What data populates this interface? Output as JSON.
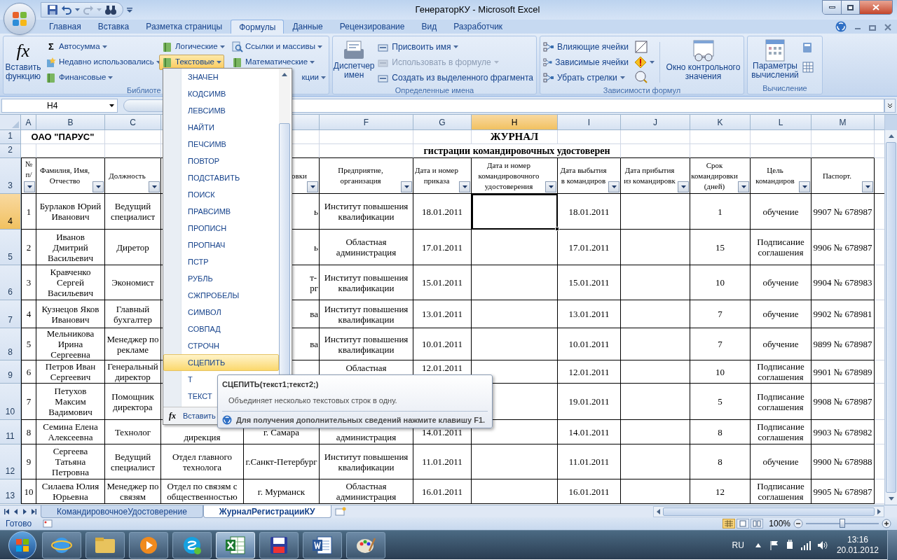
{
  "window": {
    "title": "ГенераторКУ - Microsoft Excel"
  },
  "tabs": [
    {
      "label": "Главная",
      "selected": false
    },
    {
      "label": "Вставка",
      "selected": false
    },
    {
      "label": "Разметка страницы",
      "selected": false
    },
    {
      "label": "Формулы",
      "selected": true
    },
    {
      "label": "Данные",
      "selected": false
    },
    {
      "label": "Рецензирование",
      "selected": false
    },
    {
      "label": "Вид",
      "selected": false
    },
    {
      "label": "Разработчик",
      "selected": false
    }
  ],
  "ribbon": {
    "library": {
      "label": "Библиоте",
      "insert_function": {
        "symbol": "fx",
        "label": "Вставить функцию"
      },
      "items": [
        {
          "label": "Автосумма",
          "kind": "sigma",
          "symbol": "Σ",
          "dropdown": true,
          "open": false
        },
        {
          "label": "Недавно использовались",
          "kind": "star",
          "dropdown": true,
          "open": false
        },
        {
          "label": "Финансовые",
          "kind": "book",
          "dropdown": true,
          "open": false
        },
        {
          "label": "Логические",
          "kind": "book",
          "dropdown": true,
          "open": false
        },
        {
          "label": "Текстовые",
          "kind": "book",
          "dropdown": true,
          "open": true
        },
        {
          "label": "Ссылки и массивы",
          "kind": "lens",
          "dropdown": true,
          "open": false
        },
        {
          "label": "Математические",
          "kind": "book",
          "dropdown": true,
          "open": false
        },
        {
          "label": "кции",
          "kind": "clipped",
          "dropdown": true,
          "open": false
        }
      ]
    },
    "names": {
      "label": "Определенные имена",
      "manager": "Диспетчер имен",
      "items": [
        {
          "label": "Присвоить имя",
          "dropdown": true,
          "disabled": false
        },
        {
          "label": "Использовать в формуле",
          "dropdown": true,
          "disabled": true
        },
        {
          "label": "Создать из выделенного фрагмента",
          "dropdown": false,
          "disabled": false
        }
      ]
    },
    "auditing": {
      "label": "Зависимости формул",
      "watch": "Окно контрольного значения",
      "items": [
        {
          "label": "Влияющие ячейки",
          "dropdown": false
        },
        {
          "label": "Зависимые ячейки",
          "dropdown": false
        },
        {
          "label": "Убрать стрелки",
          "dropdown": true
        }
      ]
    },
    "calculation": {
      "label": "Вычисление",
      "options": "Параметры вычислений"
    }
  },
  "formula_bar": {
    "name_box": "H4"
  },
  "sheet": {
    "columns": [
      {
        "label": "A",
        "selected": false
      },
      {
        "label": "B",
        "selected": false
      },
      {
        "label": "C",
        "selected": false
      },
      null,
      null,
      {
        "label": "F",
        "selected": false
      },
      {
        "label": "G",
        "selected": false
      },
      {
        "label": "H",
        "selected": true
      },
      {
        "label": "I",
        "selected": false
      },
      {
        "label": "J",
        "selected": false
      },
      {
        "label": "K",
        "selected": false
      },
      {
        "label": "L",
        "selected": false
      },
      {
        "label": "M",
        "selected": false
      }
    ],
    "title_rows": [
      {
        "number": "1",
        "selected": false
      },
      {
        "number": "2",
        "selected": false
      }
    ],
    "company": "ОАО \"ПАРУС\"",
    "heading": "ЖУРНАЛ",
    "subheading": "гистрации командировочных удостоверен",
    "header_row": {
      "number": "3",
      "selected": false,
      "cells": [
        {
          "text": "№ п/",
          "filter": true
        },
        {
          "text": "Фамилия, Имя, Отчество",
          "filter": true
        },
        {
          "text": "Должность",
          "filter": true
        },
        null,
        {
          "text": "овки",
          "filter": true,
          "kind": "clipped"
        },
        {
          "text": "Предприятие, организация",
          "filter": true
        },
        {
          "text": "Дата и номер приказа",
          "filter": true
        },
        {
          "text": "Дата и номер командировочного удостоверения",
          "filter": true
        },
        {
          "text": "Дата выбытия в командиров",
          "filter": true
        },
        {
          "text": "Дата прибытия из командировк",
          "filter": true
        },
        {
          "text": "Срок командировки (дней)",
          "filter": true
        },
        {
          "text": "Цель командиров",
          "filter": true
        },
        {
          "text": "Паспорт.",
          "filter": true
        }
      ]
    },
    "data_rows": [
      {
        "number": "4",
        "selected": true,
        "cells": [
          "1",
          "Бурлаков Юрий Иванович",
          "Ведущий специалист",
          null,
          {
            "text": "ь",
            "kind": "clipped"
          },
          "Институт повышения квалификации",
          "18.01.2011",
          null,
          "18.01.2011",
          null,
          "1",
          "обучение",
          "9907 № 678987"
        ]
      },
      {
        "number": "5",
        "selected": false,
        "cells": [
          "2",
          "Иванов Дмитрий Васильевич",
          "Диретор",
          null,
          {
            "text": "ь",
            "kind": "clipped"
          },
          "Областная администрация",
          "17.01.2011",
          null,
          "17.01.2011",
          null,
          "15",
          "Подписание соглашения",
          "9906 № 678987"
        ]
      },
      {
        "number": "6",
        "selected": false,
        "cells": [
          "3",
          "Кравченко Сергей Васильевич",
          "Экономист",
          null,
          {
            "text": "т-\nрг",
            "kind": "clipped"
          },
          "Институт повышения квалификации",
          "15.01.2011",
          null,
          "15.01.2011",
          null,
          "10",
          "обучение",
          "9904 № 678983"
        ]
      },
      {
        "number": "7",
        "selected": false,
        "cells": [
          "4",
          "Кузнецов Яков Иванович",
          "Главный бухгалтер",
          null,
          {
            "text": "ва",
            "kind": "clipped"
          },
          "Институт повышения квалификации",
          "13.01.2011",
          null,
          "13.01.2011",
          null,
          "7",
          "обучение",
          "9902 № 678981"
        ]
      },
      {
        "number": "8",
        "selected": false,
        "cells": [
          "5",
          "Мельникова Ирина Сергеевна",
          "Менеджер по рекламе",
          null,
          {
            "text": "ва",
            "kind": "clipped"
          },
          "Институт повышения квалификации",
          "10.01.2011",
          null,
          "10.01.2011",
          null,
          "7",
          "обучение",
          "9899 № 678987"
        ]
      },
      {
        "number": "9",
        "selected": false,
        "cells": [
          "6",
          "Петров Иван Сергеевич",
          "Генеральный директор",
          null,
          null,
          {
            "text": "Областная",
            "kind": "top"
          },
          {
            "text": "12.01.2011",
            "kind": "top"
          },
          null,
          "12.01.2011",
          null,
          "10",
          "Подписание соглашения",
          "9901 № 678989"
        ]
      },
      {
        "number": "10",
        "selected": false,
        "cells": [
          "7",
          "Петухов Максим Вадимович",
          "Помощник директора",
          null,
          null,
          null,
          null,
          null,
          "19.01.2011",
          null,
          "5",
          "Подписание соглашения",
          "9908 № 678987"
        ]
      },
      {
        "number": "11",
        "selected": false,
        "cells": [
          "8",
          "Семина Елена Алексеевна",
          "Технолог",
          {
            "text": "дирекция",
            "kind": "bottom"
          },
          "г. Самара",
          {
            "text": "администрация",
            "kind": "bottom"
          },
          "14.01.2011",
          null,
          "14.01.2011",
          null,
          "8",
          "Подписание соглашения",
          "9903 № 678982"
        ]
      },
      {
        "number": "12",
        "selected": false,
        "cells": [
          "9",
          "Сергеева Татьяна Петровна",
          "Ведущий специалист",
          "Отдел главного технолога",
          "г.Санкт-Петербург",
          "Институт повышения квалификации",
          "11.01.2011",
          null,
          "11.01.2011",
          null,
          "8",
          "обучение",
          "9900 № 678988"
        ]
      },
      {
        "number": "13",
        "selected": false,
        "cells": [
          "10",
          "Силаева Юлия Юрьевна",
          "Менеджер по связям",
          "Отдел по связям с общественностью",
          "г. Мурманск",
          "Областная администрация",
          "16.01.2011",
          null,
          "16.01.2011",
          null,
          "12",
          "Подписание соглашения",
          "9905 № 678987"
        ]
      }
    ]
  },
  "menu": {
    "items": [
      {
        "label": "ЗНАЧЕН",
        "selected": false
      },
      {
        "label": "КОДСИМВ",
        "selected": false
      },
      {
        "label": "ЛЕВСИМВ",
        "selected": false
      },
      {
        "label": "НАЙТИ",
        "selected": false
      },
      {
        "label": "ПЕЧСИМВ",
        "selected": false
      },
      {
        "label": "ПОВТОР",
        "selected": false
      },
      {
        "label": "ПОДСТАВИТЬ",
        "selected": false
      },
      {
        "label": "ПОИСК",
        "selected": false
      },
      {
        "label": "ПРАВСИМВ",
        "selected": false
      },
      {
        "label": "ПРОПИСН",
        "selected": false
      },
      {
        "label": "ПРОПНАЧ",
        "selected": false
      },
      {
        "label": "ПСТР",
        "selected": false
      },
      {
        "label": "РУБЛЬ",
        "selected": false
      },
      {
        "label": "СЖПРОБЕЛЫ",
        "selected": false
      },
      {
        "label": "СИМВОЛ",
        "selected": false
      },
      {
        "label": "СОВПАД",
        "selected": false
      },
      {
        "label": "СТРОЧН",
        "selected": false
      },
      {
        "label": "СЦЕПИТЬ",
        "selected": true
      },
      {
        "label": "Т",
        "selected": false
      },
      {
        "label": "ТЕКСТ",
        "selected": false
      }
    ],
    "footer_symbol": "fx",
    "footer": "Вставить"
  },
  "tooltip": {
    "title": "СЦЕПИТЬ(текст1;текст2;)",
    "description": "Объединяет несколько текстовых строк в одну.",
    "help": "Для получения дополнительных сведений нажмите клавишу F1."
  },
  "sheet_tabs": [
    {
      "label": "КомандировочноеУдостоверение",
      "selected": false
    },
    {
      "label": "ЖурналРегистрацииКУ",
      "selected": true
    }
  ],
  "status_bar": {
    "status": "Готово",
    "zoom": "100%",
    "level": 0.5
  },
  "taskbar": {
    "apps": [
      {
        "kind": "browser",
        "active": false
      },
      {
        "kind": "folder",
        "active": false
      },
      {
        "kind": "media",
        "active": false
      },
      {
        "kind": "skype",
        "active": false
      },
      {
        "kind": "sheet",
        "active": true
      },
      {
        "kind": "disk",
        "active": false
      },
      {
        "kind": "doc",
        "active": false
      },
      {
        "kind": "paint",
        "active": false
      }
    ],
    "language": "RU",
    "time": "13:16",
    "date": "20.01.2012"
  }
}
